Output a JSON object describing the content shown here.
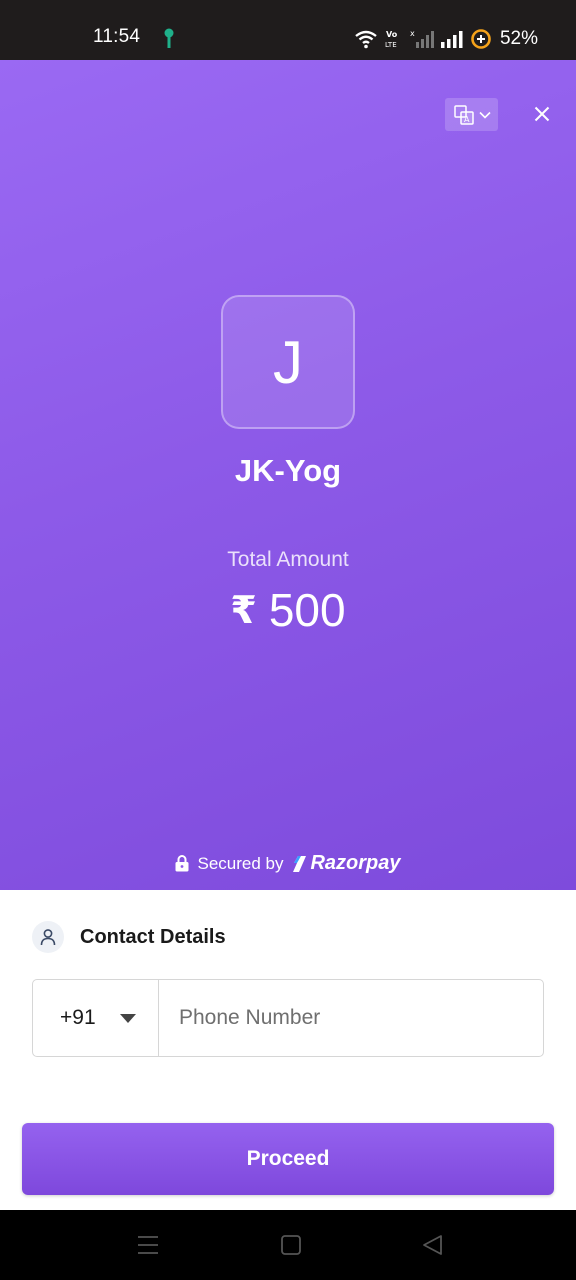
{
  "status_bar": {
    "time": "11:54",
    "battery": "52%",
    "icons": [
      "key-icon",
      "wifi-icon",
      "volte-icon",
      "signal-sim1-icon",
      "signal-sim2-icon",
      "battery-saver-icon"
    ]
  },
  "header": {
    "language_icon": "translate-icon",
    "close_icon": "close-icon",
    "merchant_initial": "J",
    "merchant_name": "JK-Yog",
    "amount_label": "Total Amount",
    "currency_symbol": "₹",
    "amount": "500",
    "secured_text": "Secured by",
    "brand": "Razorpay"
  },
  "contact": {
    "title": "Contact Details",
    "country_code": "+91",
    "phone_placeholder": "Phone Number",
    "phone_value": ""
  },
  "actions": {
    "proceed_label": "Proceed"
  },
  "colors": {
    "accent": "#8d5ae8",
    "accent_dark": "#7e48dc",
    "status_bar": "#1f1c1c",
    "key_icon": "#1fb08a"
  }
}
